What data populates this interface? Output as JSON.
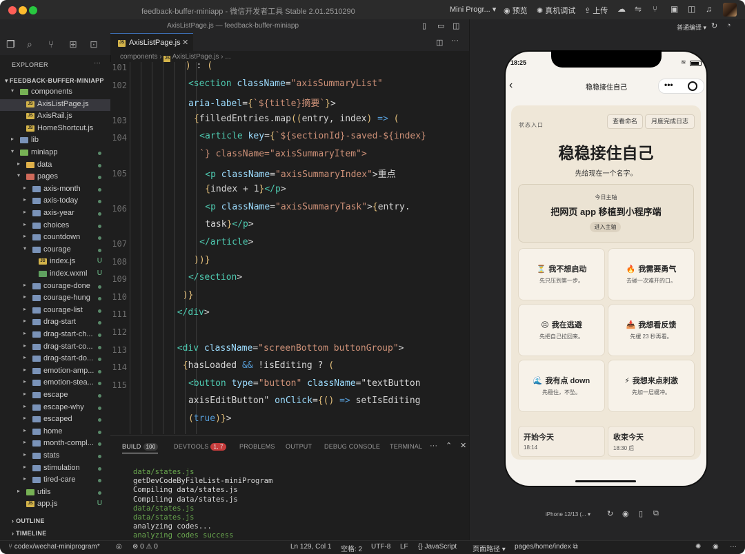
{
  "window": {
    "title": "feedback-buffer-miniapp - 微信开发者工具 Stable 2.01.2510290",
    "subtitle": "AxisListPage.js — feedback-buffer-miniapp",
    "toolbar": {
      "mode": "Mini Progr...",
      "preview": "预览",
      "remote_debug": "真机调试",
      "upload": "上传"
    },
    "compile_mode": "普通编译"
  },
  "sidebar": {
    "header": "EXPLORER",
    "project": "FEEDBACK-BUFFER-MINIAPP",
    "tree": [
      {
        "label": "components",
        "depth": 1,
        "kind": "folder",
        "color": "green",
        "open": true
      },
      {
        "label": "AxisListPage.js",
        "depth": 2,
        "kind": "js",
        "selected": true
      },
      {
        "label": "AxisRail.js",
        "depth": 2,
        "kind": "js"
      },
      {
        "label": "HomeShortcut.js",
        "depth": 2,
        "kind": "js"
      },
      {
        "label": "lib",
        "depth": 1,
        "kind": "folder",
        "color": "plain"
      },
      {
        "label": "miniapp",
        "depth": 1,
        "kind": "folder",
        "color": "green",
        "open": true,
        "dot": true
      },
      {
        "label": "data",
        "depth": 2,
        "kind": "folder",
        "color": "yellow",
        "dot": true
      },
      {
        "label": "pages",
        "depth": 2,
        "kind": "folder",
        "color": "red",
        "open": true,
        "dot": true
      },
      {
        "label": "axis-month",
        "depth": 3,
        "kind": "folder",
        "color": "plain",
        "dot": true
      },
      {
        "label": "axis-today",
        "depth": 3,
        "kind": "folder",
        "color": "plain",
        "dot": true
      },
      {
        "label": "axis-year",
        "depth": 3,
        "kind": "folder",
        "color": "plain",
        "dot": true
      },
      {
        "label": "choices",
        "depth": 3,
        "kind": "folder",
        "color": "plain",
        "dot": true
      },
      {
        "label": "countdown",
        "depth": 3,
        "kind": "folder",
        "color": "plain",
        "dot": true
      },
      {
        "label": "courage",
        "depth": 3,
        "kind": "folder",
        "color": "plain",
        "open": true,
        "dot": true
      },
      {
        "label": "index.js",
        "depth": 4,
        "kind": "js",
        "mark": "U"
      },
      {
        "label": "index.wxml",
        "depth": 4,
        "kind": "wxml",
        "mark": "U"
      },
      {
        "label": "courage-done",
        "depth": 3,
        "kind": "folder",
        "color": "plain",
        "dot": true
      },
      {
        "label": "courage-hung",
        "depth": 3,
        "kind": "folder",
        "color": "plain",
        "dot": true
      },
      {
        "label": "courage-list",
        "depth": 3,
        "kind": "folder",
        "color": "plain",
        "dot": true
      },
      {
        "label": "drag-start",
        "depth": 3,
        "kind": "folder",
        "color": "plain",
        "dot": true
      },
      {
        "label": "drag-start-ch...",
        "depth": 3,
        "kind": "folder",
        "color": "plain",
        "dot": true
      },
      {
        "label": "drag-start-co...",
        "depth": 3,
        "kind": "folder",
        "color": "plain",
        "dot": true
      },
      {
        "label": "drag-start-do...",
        "depth": 3,
        "kind": "folder",
        "color": "plain",
        "dot": true
      },
      {
        "label": "emotion-amp...",
        "depth": 3,
        "kind": "folder",
        "color": "plain",
        "dot": true
      },
      {
        "label": "emotion-stea...",
        "depth": 3,
        "kind": "folder",
        "color": "plain",
        "dot": true
      },
      {
        "label": "escape",
        "depth": 3,
        "kind": "folder",
        "color": "plain",
        "dot": true
      },
      {
        "label": "escape-why",
        "depth": 3,
        "kind": "folder",
        "color": "plain",
        "dot": true
      },
      {
        "label": "escaped",
        "depth": 3,
        "kind": "folder",
        "color": "plain",
        "dot": true
      },
      {
        "label": "home",
        "depth": 3,
        "kind": "folder",
        "color": "plain",
        "dot": true
      },
      {
        "label": "month-compl...",
        "depth": 3,
        "kind": "folder",
        "color": "plain",
        "dot": true
      },
      {
        "label": "stats",
        "depth": 3,
        "kind": "folder",
        "color": "plain",
        "dot": true
      },
      {
        "label": "stimulation",
        "depth": 3,
        "kind": "folder",
        "color": "plain",
        "dot": true
      },
      {
        "label": "tired-care",
        "depth": 3,
        "kind": "folder",
        "color": "plain",
        "dot": true
      },
      {
        "label": "utils",
        "depth": 2,
        "kind": "folder",
        "color": "green",
        "dot": true
      },
      {
        "label": "app.js",
        "depth": 2,
        "kind": "js",
        "mark": "U"
      }
    ],
    "outline": "OUTLINE",
    "timeline": "TIMELINE"
  },
  "editor": {
    "tab": "AxisListPage.js",
    "breadcrumb": [
      "components",
      "AxisListPage.js",
      "..."
    ],
    "lines": [
      {
        "n": "101",
        "t": ") : ("
      },
      {
        "n": "102",
        "t": "<section className=\"axisSummaryList\""
      },
      {
        "n": "",
        "t": "aria-label={`${title}摘要`}>"
      },
      {
        "n": "103",
        "t": "{filledEntries.map((entry, index) => ("
      },
      {
        "n": "104",
        "t": "<article key={`${sectionId}-saved-${index}"
      },
      {
        "n": "",
        "t": "`} className=\"axisSummaryItem\">"
      },
      {
        "n": "105",
        "t": "<p className=\"axisSummaryIndex\">重点"
      },
      {
        "n": "",
        "t": "{index + 1}</p>"
      },
      {
        "n": "106",
        "t": "<p className=\"axisSummaryTask\">{entry."
      },
      {
        "n": "",
        "t": "task}</p>"
      },
      {
        "n": "107",
        "t": "</article>"
      },
      {
        "n": "108",
        "t": "))}"
      },
      {
        "n": "109",
        "t": "</section>"
      },
      {
        "n": "110",
        "t": ")}"
      },
      {
        "n": "111",
        "t": "</div>"
      },
      {
        "n": "112",
        "t": ""
      },
      {
        "n": "113",
        "t": "<div className=\"screenBottom buttonGroup\">"
      },
      {
        "n": "114",
        "t": "{hasLoaded && !isEditing ? ("
      },
      {
        "n": "115",
        "t": "<button type=\"button\" className=\"textButton"
      },
      {
        "n": "",
        "t": "axisEditButton\" onClick={() => setIsEditing"
      },
      {
        "n": "",
        "t": "(true)}>"
      }
    ]
  },
  "panel": {
    "tabs": [
      {
        "label": "BUILD",
        "badge": "100"
      },
      {
        "label": "DEVTOOLS",
        "badge": "1, 7"
      },
      {
        "label": "PROBLEMS"
      },
      {
        "label": "OUTPUT"
      },
      {
        "label": "DEBUG CONSOLE"
      },
      {
        "label": "TERMINAL"
      }
    ],
    "log": [
      {
        "t": "data/states.js",
        "c": "green"
      },
      {
        "t": "getDevCodeByFileList-miniProgram",
        "c": "white"
      },
      {
        "t": "Compiling data/states.js",
        "c": "white"
      },
      {
        "t": "Compiling data/states.js",
        "c": "white"
      },
      {
        "t": "data/states.js",
        "c": "green"
      },
      {
        "t": "data/states.js",
        "c": "green"
      },
      {
        "t": "analyzing codes...",
        "c": "white"
      },
      {
        "t": "analyzing codes success",
        "c": "green"
      }
    ]
  },
  "statusbar": {
    "branch": "codex/wechat-miniprogram*",
    "errors": "0",
    "warnings": "0",
    "position": "Ln 129, Col 1",
    "spaces": "空格: 2",
    "encoding": "UTF-8",
    "eol": "LF",
    "language": "JavaScript",
    "page_path_label": "页面路径",
    "page_path": "pages/home/index"
  },
  "simulator": {
    "device": "iPhone 12/13 (...",
    "phone": {
      "time": "18:25",
      "nav_title": "稳稳接住自己",
      "entry_label": "状态入口",
      "btn_name": "查看命名",
      "btn_month": "月度完成日志",
      "heading": "稳稳接住自己",
      "subheading": "先给现在一个名字。",
      "focus": {
        "label": "今日主轴",
        "title": "把网页 app 移植到小程序端",
        "button": "进入主轴"
      },
      "grid": [
        {
          "emoji": "⏳",
          "title": "我不想启动",
          "sub": "先只压到第一步。"
        },
        {
          "emoji": "🔥",
          "title": "我需要勇气",
          "sub": "去碰一次难开的口。"
        },
        {
          "emoji": "😣",
          "title": "我在逃避",
          "sub": "先把自己拉回来。"
        },
        {
          "emoji": "📥",
          "title": "我想看反馈",
          "sub": "先缓 23 秒再看。"
        },
        {
          "emoji": "🌊",
          "title": "我有点 down",
          "sub": "先稳住，不坠。"
        },
        {
          "emoji": "⚡",
          "title": "我想来点刺激",
          "sub": "先加一层缓冲。"
        }
      ],
      "bottom": [
        {
          "title": "开始今天",
          "sub": "18:14"
        },
        {
          "title": "收束今天",
          "sub": "18:30 后"
        }
      ]
    }
  },
  "colors": {
    "keyword": "#569cd6",
    "tag": "#4ec9b0",
    "string": "#ce9178",
    "attr": "#9cdcfe",
    "punct": "#c8c8c8",
    "green_log": "#6a9955",
    "accent": "#3d6fb5"
  }
}
